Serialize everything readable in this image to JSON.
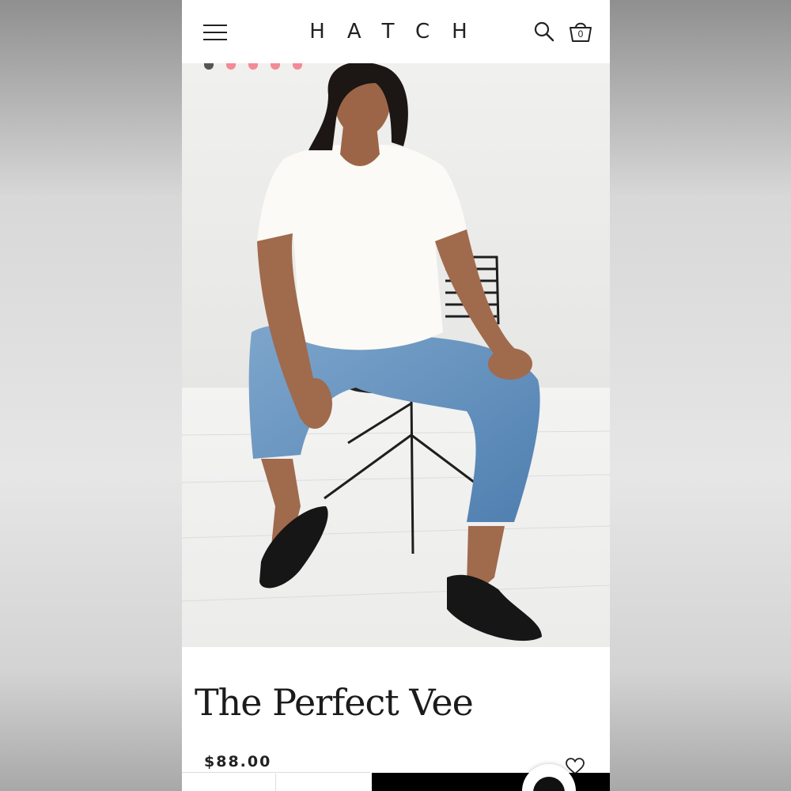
{
  "header": {
    "brand": "HATCH",
    "cart_count": "0"
  },
  "carousel": {
    "dots": [
      {
        "active": true,
        "color": "#555555"
      },
      {
        "active": false,
        "color": "#f28b96"
      },
      {
        "active": false,
        "color": "#f28b96"
      },
      {
        "active": false,
        "color": "#f28b96"
      },
      {
        "active": false,
        "color": "#f28b96"
      }
    ]
  },
  "product": {
    "title": "The Perfect Vee",
    "price": "$88.00"
  },
  "icons": {
    "menu": "hamburger-menu-icon",
    "search": "search-icon",
    "cart": "shopping-bag-icon",
    "wishlist": "heart-icon",
    "chat": "chat-icon"
  },
  "colors": {
    "accent_dot": "#f28b96",
    "text": "#1b1b1b",
    "button": "#000000"
  }
}
